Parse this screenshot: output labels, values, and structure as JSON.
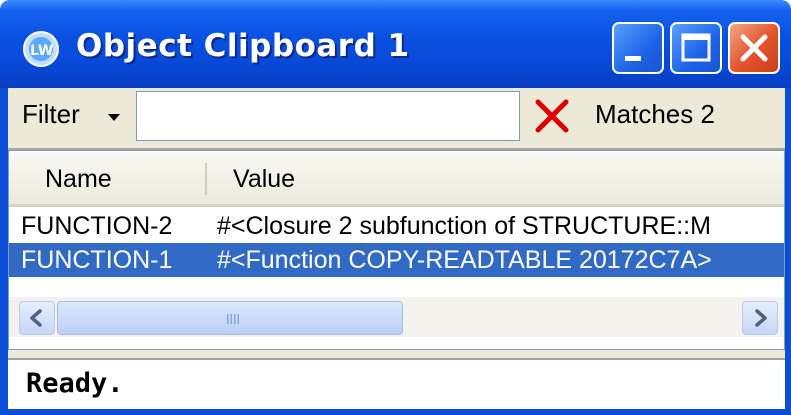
{
  "window": {
    "title": "Object Clipboard 1",
    "app_icon": "lw-logo-icon",
    "controls": {
      "minimize_icon": "minimize-icon",
      "maximize_icon": "maximize-icon",
      "close_icon": "close-icon"
    }
  },
  "toolbar": {
    "filter_label": "Filter",
    "filter_dropdown_icon": "chevron-down-icon",
    "filter_value": "",
    "filter_placeholder": "",
    "clear_icon": "red-x-icon",
    "matches_text": "Matches 2"
  },
  "list": {
    "columns": [
      "Name",
      "Value"
    ],
    "rows": [
      {
        "name": "FUNCTION-2",
        "value": "#<Closure 2 subfunction of STRUCTURE::M",
        "selected": false
      },
      {
        "name": "FUNCTION-1",
        "value": "#<Function COPY-READTABLE 20172C7A>",
        "selected": true
      }
    ]
  },
  "scrollbar": {
    "left_icon": "arrow-left-icon",
    "right_icon": "arrow-right-icon",
    "grip_icon": "grip-icon"
  },
  "status": {
    "text": "Ready."
  },
  "colors": {
    "titlebar": "#0a50e0",
    "selection": "#316ac5",
    "close_button": "#e2522c",
    "clear_x": "#e00000"
  }
}
